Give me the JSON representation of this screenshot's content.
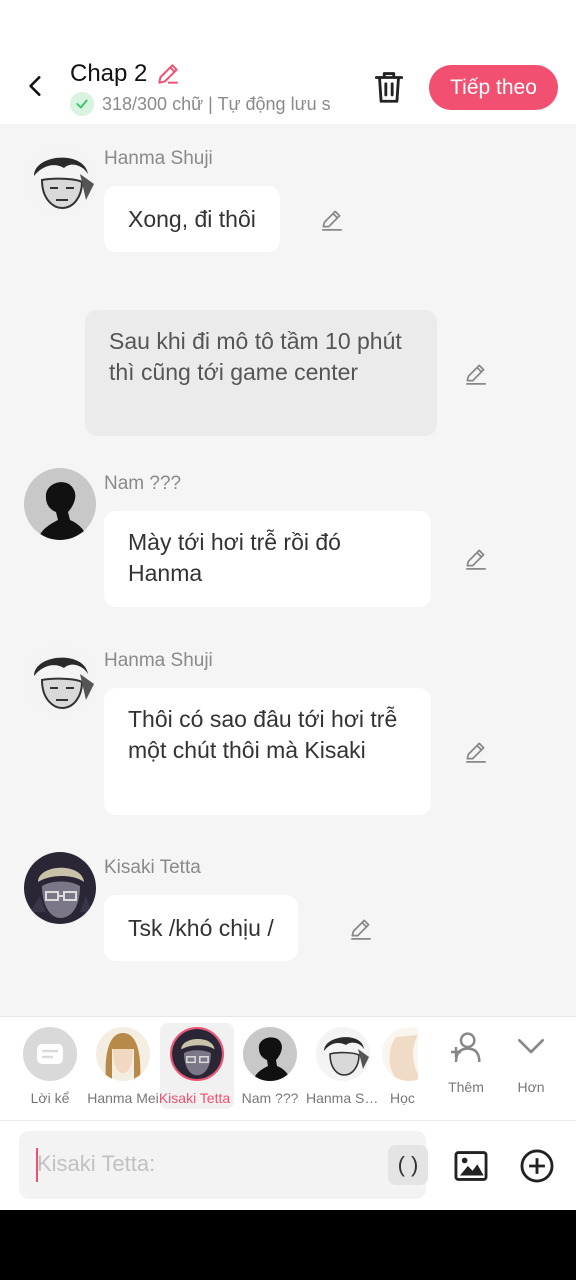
{
  "header": {
    "title": "Chap 2",
    "status_text": "318/300 chữ | Tự động lưu s",
    "next_label": "Tiếp theo"
  },
  "messages": [
    {
      "speaker": "Hanma Shuji",
      "text": "Xong, đi thôi"
    },
    {
      "speaker": "",
      "text": "Sau khi đi mô tô tầm 10 phút thì cũng tới game center"
    },
    {
      "speaker": "Nam ???",
      "text": "Mày tới hơi trễ rồi đó Hanma"
    },
    {
      "speaker": "Hanma Shuji",
      "text": "Thôi có sao đâu tới hơi trễ một chút thôi mà Kisaki"
    },
    {
      "speaker": "Kisaki Tetta",
      "text": "Tsk /khó chịu /"
    }
  ],
  "characters": [
    {
      "label": "Lời kể"
    },
    {
      "label": "Hanma Mei"
    },
    {
      "label": "Kisaki Tetta",
      "selected": true
    },
    {
      "label": "Nam ???"
    },
    {
      "label": "Hanma Sh..."
    },
    {
      "label": "Học"
    }
  ],
  "actions": {
    "add_label": "Thêm",
    "more_label": "Hơn"
  },
  "input": {
    "placeholder": "Kisaki Tetta:",
    "paren_label": "( )"
  },
  "colors": {
    "accent": "#f15071",
    "background": "#f5f5f5",
    "bubble": "#ffffff",
    "narration_bubble": "#ebebeb",
    "check": "#3cc46a"
  }
}
